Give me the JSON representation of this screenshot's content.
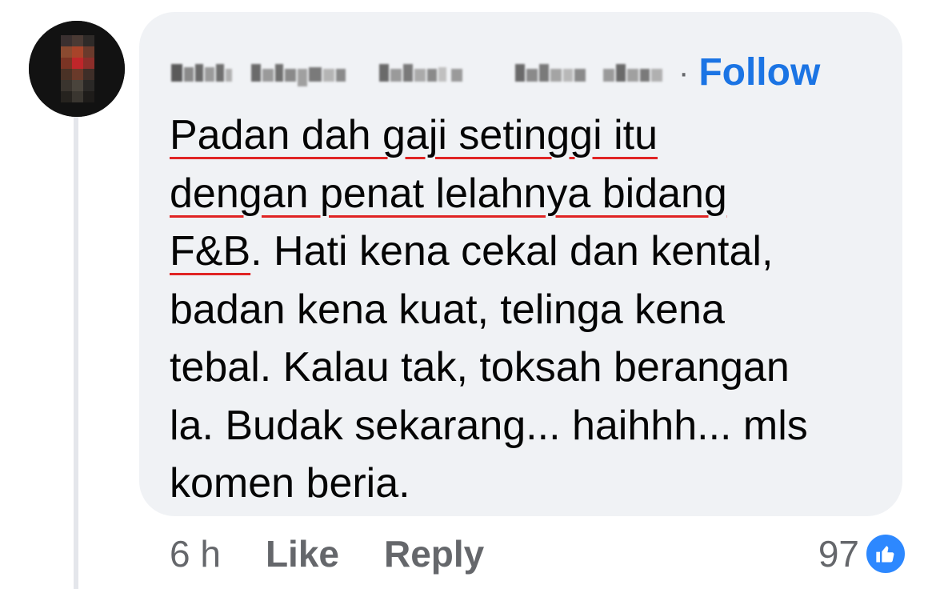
{
  "comment": {
    "author_name": "",
    "separator": "·",
    "follow_label": "Follow",
    "text_lines": [
      "Padan dah gaji setinggi itu",
      "dengan penat lelahnya bidang",
      "F&B",
      ". Hati kena cekal dan kental,",
      "badan kena kuat, telinga kena",
      "tebal. Kalau tak, toksah berangan",
      "la. Budak sekarang... haihhh... mls",
      "komen beria."
    ],
    "underline_color": "#e02424"
  },
  "meta": {
    "time": "6 h",
    "like_label": "Like",
    "reply_label": "Reply"
  },
  "reactions": {
    "count": "97",
    "icon": "thumbs-up-icon",
    "color": "#2d88ff"
  },
  "colors": {
    "bubble": "#f0f2f5",
    "link": "#1b74e4",
    "meta_text": "#65676b",
    "body_text": "#050505"
  }
}
